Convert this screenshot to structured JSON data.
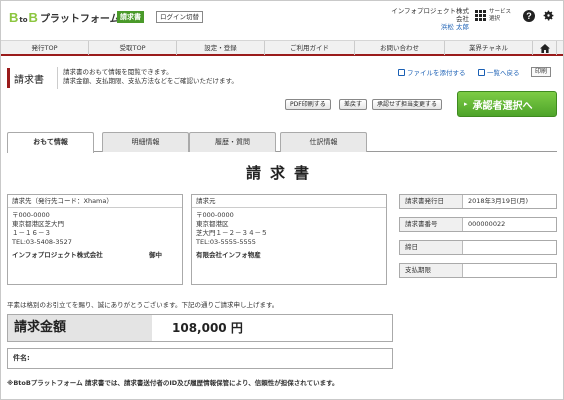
{
  "header": {
    "logo_b1": "B",
    "logo_to": "to",
    "logo_b2": "B",
    "logo_text": "プラットフォーム",
    "tag": "請求書",
    "login_switch": "ログイン切替",
    "company": "インフォプロジェクト株式会社",
    "user": "浜松 太郎",
    "service_line1": "サービス",
    "service_line2": "選択",
    "help": "?"
  },
  "nav": {
    "items": [
      "発行TOP",
      "受取TOP",
      "設定・登録",
      "ご利用ガイド",
      "お問い合わせ",
      "業界チャネル"
    ]
  },
  "page": {
    "title": "請求書",
    "desc_line1": "請求書のおもて情報を閲覧できます。",
    "desc_line2": "請求金額、支払期限、支払方法などをご確認いただけます。",
    "link_attach": "ファイルを添付する",
    "link_back": "一覧へ戻る",
    "btn_print": "印刷",
    "btn_pdf": "PDF印刷する",
    "btn_reject": "差戻す",
    "btn_change": "承認せず担当変更する",
    "btn_approver": "承認者選択へ"
  },
  "tabs": [
    "おもて情報",
    "明細情報",
    "履歴・質問",
    "仕訳情報"
  ],
  "doc_title": "請求書",
  "bill_to": {
    "header": "請求先（発行先コード：Xhama）",
    "zip": "〒000-0000",
    "addr1": "東京都港区芝大門",
    "addr2": "１－１６－３",
    "tel": "TEL:03-5408-3527",
    "firm": "インフォプロジェクト株式会社",
    "honor": "御中"
  },
  "bill_from": {
    "header": "請求元",
    "zip": "〒000-0000",
    "addr1": "東京都港区",
    "addr2": "芝大門１－２－３４－５",
    "tel": "TEL:03-5555-5555",
    "firm": "有限会社インフォ物産"
  },
  "meta": [
    {
      "key": "請求書発行日",
      "value": "2018年3月19日(月)"
    },
    {
      "key": "請求書番号",
      "value": "000000022"
    },
    {
      "key": "締日",
      "value": ""
    },
    {
      "key": "支払期限",
      "value": ""
    }
  ],
  "greeting": "平素は格別のお引立てを賜り、誠にありがとうございます。下記の通りご請求申し上げます。",
  "amount": {
    "label": "請求金額",
    "value": "108,000 円"
  },
  "subject_label": "件名:",
  "footer_note": "※BtoBプラットフォーム 請求書では、請求書送付者のID及び履歴情報保管により、信頼性が担保されています。",
  "colors": {
    "accent_red": "#9a1b1b",
    "brand_green": "#8cc63f",
    "button_green": "#5cb335",
    "link_blue": "#1a5fb4"
  }
}
